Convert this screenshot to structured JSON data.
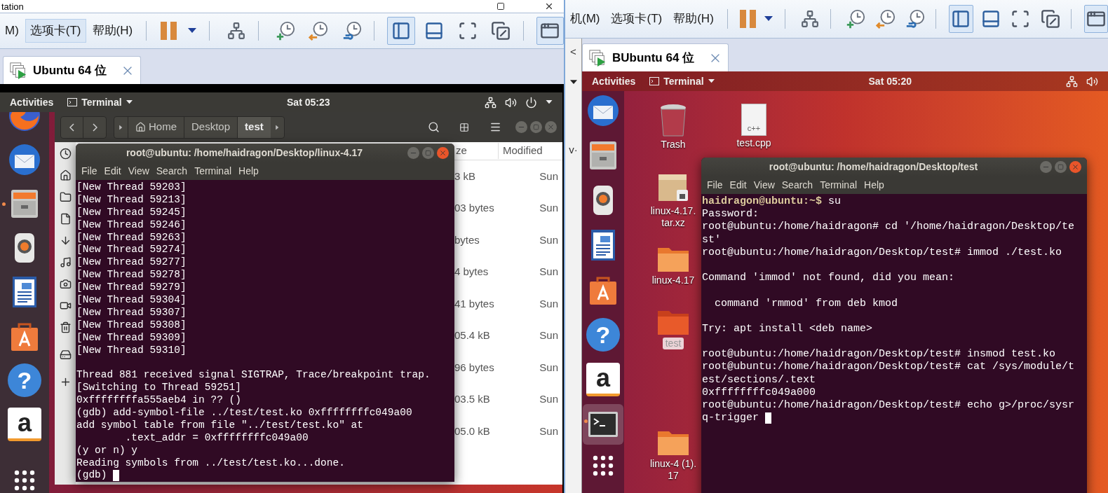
{
  "left_vm": {
    "window_title": "tation",
    "menu": [
      {
        "label": "M)",
        "selected": false
      },
      {
        "label": "选项卡(T)",
        "selected": true
      },
      {
        "label": "帮助(H)",
        "selected": false
      }
    ],
    "toolbar": [
      {
        "kind": "pause",
        "on": false
      },
      {
        "kind": "dropdown",
        "on": false
      },
      {
        "kind": "separator"
      },
      {
        "kind": "sendkeys",
        "on": false
      },
      {
        "kind": "separator"
      },
      {
        "kind": "snap_take",
        "on": false
      },
      {
        "kind": "snap_revert",
        "on": false
      },
      {
        "kind": "snap_manage",
        "on": false
      },
      {
        "kind": "separator"
      },
      {
        "kind": "view_sidebar",
        "on": true
      },
      {
        "kind": "view_bar",
        "on": false
      },
      {
        "kind": "fullscreen",
        "on": false
      },
      {
        "kind": "unity",
        "on": false
      },
      {
        "kind": "separator"
      },
      {
        "kind": "thumbnails",
        "on": true
      }
    ],
    "tab": {
      "label": "Ubuntu 64 位"
    },
    "topbar": {
      "activities": "Activities",
      "app_menu": "Terminal",
      "clock": "Sat 05:23"
    },
    "dock": [
      {
        "kind": "firefox",
        "running": false
      },
      {
        "kind": "thunderbird",
        "running": false
      },
      {
        "kind": "files",
        "running": true
      },
      {
        "kind": "rhythmbox",
        "running": false
      },
      {
        "kind": "writer",
        "running": false
      },
      {
        "kind": "software",
        "running": false
      },
      {
        "kind": "help",
        "glyph": "?",
        "running": false
      },
      {
        "kind": "amazon",
        "glyph": "a",
        "running": false
      }
    ],
    "file_manager": {
      "path": [
        {
          "label": "Home",
          "selected": false
        },
        {
          "label": "Desktop",
          "selected": false
        },
        {
          "label": "test",
          "selected": true
        }
      ],
      "columns": [
        "ze",
        "Modified"
      ],
      "rows": [
        {
          "size": "3 kB",
          "modified": "Sun"
        },
        {
          "size": "03 bytes",
          "modified": "Sun"
        },
        {
          "size": "bytes",
          "modified": "Sun"
        },
        {
          "size": "4 bytes",
          "modified": "Sun"
        },
        {
          "size": "41 bytes",
          "modified": "Sun"
        },
        {
          "size": "05.4 kB",
          "modified": "Sun"
        },
        {
          "size": "96 bytes",
          "modified": "Sun"
        },
        {
          "size": "03.5 kB",
          "modified": "Sun"
        },
        {
          "size": "05.0 kB",
          "modified": "Sun"
        }
      ]
    },
    "terminal": {
      "title": "root@ubuntu: /home/haidragon/Desktop/linux-4.17",
      "menu": [
        "File",
        "Edit",
        "View",
        "Search",
        "Terminal",
        "Help"
      ],
      "blocks": [
        [
          {
            "text": "[New Thread 59203]"
          },
          {
            "text": "[New Thread 59213]"
          },
          {
            "text": "[New Thread 59245]"
          },
          {
            "text": "[New Thread 59246]"
          },
          {
            "text": "[New Thread 59263]"
          },
          {
            "text": "[New Thread 59274]"
          },
          {
            "text": "[New Thread 59277]"
          },
          {
            "text": "[New Thread 59278]"
          },
          {
            "text": "[New Thread 59279]"
          },
          {
            "text": "[New Thread 59304]"
          },
          {
            "text": "[New Thread 59307]"
          },
          {
            "text": "[New Thread 59308]"
          },
          {
            "text": "[New Thread 59309]"
          },
          {
            "text": "[New Thread 59310]"
          }
        ],
        [
          {
            "text": "Thread 881 received signal SIGTRAP, Trace/breakpoint trap."
          },
          {
            "text": "[Switching to Thread 59251]"
          },
          {
            "text": "0xffffffffa555aeb4 in ?? ()"
          },
          {
            "text": "(gdb) add-symbol-file ../test/test.ko 0xffffffffc049a00"
          },
          {
            "text": "add symbol table from file \"../test/test.ko\" at"
          },
          {
            "text": "        .text_addr = 0xffffffffc049a00"
          },
          {
            "text": "(y or n) y"
          },
          {
            "text": "Reading symbols from ../test/test.ko...done."
          },
          {
            "text": "(gdb) "
          }
        ]
      ],
      "cursor": true
    }
  },
  "right_vm": {
    "fragments": [
      "<",
      "v·"
    ],
    "menu": [
      {
        "label": "机(M)",
        "selected": false
      },
      {
        "label": "选项卡(T)",
        "selected": false
      },
      {
        "label": "帮助(H)",
        "selected": false
      }
    ],
    "toolbar": [
      {
        "kind": "pause",
        "on": false
      },
      {
        "kind": "dropdown",
        "on": false
      },
      {
        "kind": "separator"
      },
      {
        "kind": "sendkeys",
        "on": false
      },
      {
        "kind": "separator"
      },
      {
        "kind": "snap_take",
        "on": false
      },
      {
        "kind": "snap_revert",
        "on": false
      },
      {
        "kind": "snap_manage",
        "on": false
      },
      {
        "kind": "separator"
      },
      {
        "kind": "view_sidebar",
        "on": true
      },
      {
        "kind": "view_bar",
        "on": false
      },
      {
        "kind": "fullscreen",
        "on": false
      },
      {
        "kind": "unity",
        "on": false
      },
      {
        "kind": "separator"
      },
      {
        "kind": "thumbnails",
        "on": true
      }
    ],
    "tab": {
      "label": "BUbuntu 64 位"
    },
    "topbar": {
      "activities": "Activities",
      "app_menu": "Terminal",
      "clock": "Sat 05:20"
    },
    "dock": [
      {
        "kind": "thunderbird",
        "running": false,
        "active": false
      },
      {
        "kind": "files",
        "running": false,
        "active": false
      },
      {
        "kind": "rhythmbox",
        "running": false,
        "active": false
      },
      {
        "kind": "writer",
        "running": false,
        "active": false
      },
      {
        "kind": "software",
        "running": false,
        "active": false
      },
      {
        "kind": "help",
        "glyph": "?",
        "running": false,
        "active": false
      },
      {
        "kind": "amazon",
        "glyph": "a",
        "running": false,
        "active": false
      },
      {
        "kind": "terminal",
        "running": true,
        "active": true
      }
    ],
    "desktop_icons": [
      {
        "kind": "trash",
        "label_lines": [
          "Trash"
        ],
        "selected": false
      },
      {
        "kind": "document",
        "icon_text": "c++",
        "label_lines": [
          "test.cpp"
        ],
        "selected": false
      },
      {
        "kind": "archive",
        "label_lines": [
          "linux-4.17.",
          "tar.xz"
        ],
        "selected": false
      },
      {
        "kind": "folder",
        "label_lines": [
          "linux-4.17"
        ],
        "selected": false
      },
      {
        "kind": "folder",
        "label_lines": [
          "test"
        ],
        "selected": true
      },
      {
        "kind": "folder",
        "label_lines": [
          "linux-4 (1).",
          "17"
        ],
        "selected": false
      }
    ],
    "terminal": {
      "title": "root@ubuntu: /home/haidragon/Desktop/test",
      "menu": [
        "File",
        "Edit",
        "View",
        "Search",
        "Terminal",
        "Help"
      ],
      "blocks": [
        [
          {
            "prompt": "haidragon@ubuntu:~$",
            "text": " su"
          },
          {
            "text": "Password:"
          },
          {
            "text": "root@ubuntu:/home/haidragon# cd '/home/haidragon/Desktop/te"
          },
          {
            "text": "st'"
          },
          {
            "text": "root@ubuntu:/home/haidragon/Desktop/test# immod ./test.ko"
          }
        ],
        [
          {
            "text": "Command 'immod' not found, did you mean:"
          }
        ],
        [
          {
            "text": "  command 'rmmod' from deb kmod"
          }
        ],
        [
          {
            "text": "Try: apt install <deb name>"
          }
        ],
        [
          {
            "text": "root@ubuntu:/home/haidragon/Desktop/test# insmod test.ko"
          },
          {
            "text": "root@ubuntu:/home/haidragon/Desktop/test# cat /sys/module/t"
          },
          {
            "text": "est/sections/.text"
          },
          {
            "text": "0xffffffffc049a000"
          },
          {
            "text": "root@ubuntu:/home/haidragon/Desktop/test# echo g>/proc/sysr"
          },
          {
            "text": "q-trigger "
          }
        ]
      ],
      "cursor": true
    }
  }
}
